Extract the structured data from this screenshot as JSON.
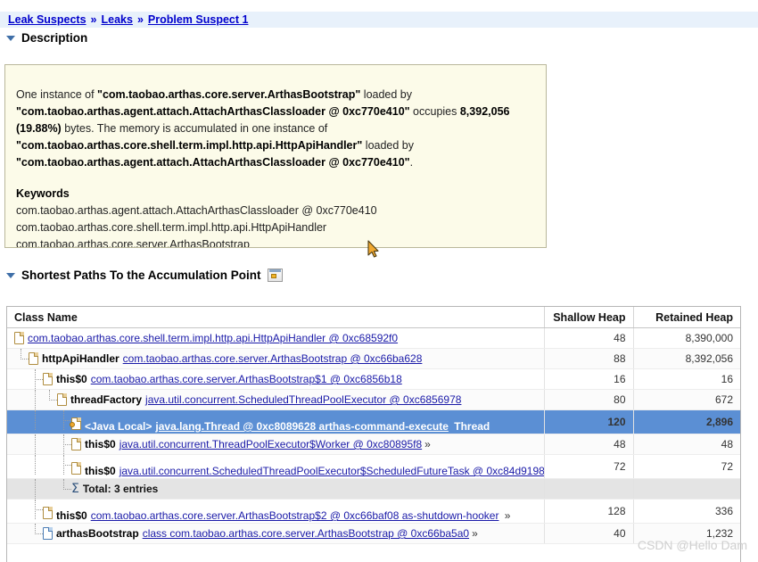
{
  "breadcrumb": {
    "items": [
      "Leak Suspects",
      "Leaks",
      "Problem Suspect 1"
    ],
    "separator": "»"
  },
  "sections": {
    "description": {
      "title": "Description"
    },
    "paths": {
      "title": "Shortest Paths To the Accumulation Point",
      "icon": "open-in-editor-icon"
    }
  },
  "description": {
    "paragraph": {
      "p1": "One instance of ",
      "b1": "\"com.taobao.arthas.core.server.ArthasBootstrap\"",
      "p2": " loaded by ",
      "b2": "\"com.taobao.arthas.agent.attach.AttachArthasClassloader @ 0xc770e410\"",
      "p3": " occupies ",
      "b3": "8,392,056 (19.88%)",
      "p4": " bytes. The memory is accumulated in one instance of ",
      "b4": "\"com.taobao.arthas.core.shell.term.impl.http.api.HttpApiHandler\"",
      "p5": " loaded by ",
      "b5": "\"com.taobao.arthas.agent.attach.AttachArthasClassloader @ 0xc770e410\"",
      "p6": "."
    },
    "keywords_title": "Keywords",
    "keywords": [
      "com.taobao.arthas.agent.attach.AttachArthasClassloader @ 0xc770e410",
      "com.taobao.arthas.core.shell.term.impl.http.api.HttpApiHandler",
      "com.taobao.arthas.core.server.ArthasBootstrap"
    ]
  },
  "table": {
    "columns": [
      "Class Name",
      "Shallow Heap",
      "Retained Heap"
    ],
    "rows": [
      {
        "depth": 0,
        "guides": [],
        "icon": "object-icon",
        "field": "",
        "class": "com.taobao.arthas.core.shell.term.impl.http.api.HttpApiHandler @ 0xc68592f0",
        "tail": "",
        "shallow": "48",
        "retained": "8,390,000",
        "selected": false,
        "wrapped": false,
        "total": false
      },
      {
        "depth": 1,
        "guides": [
          "ell"
        ],
        "icon": "object-icon",
        "field": "httpApiHandler",
        "class": "com.taobao.arthas.core.server.ArthasBootstrap @ 0xc66ba628",
        "tail": "",
        "shallow": "88",
        "retained": "8,392,056",
        "selected": false,
        "wrapped": false,
        "total": false
      },
      {
        "depth": 2,
        "guides": [
          "blank",
          "tee"
        ],
        "icon": "object-icon",
        "field": "this$0",
        "class": "com.taobao.arthas.core.server.ArthasBootstrap$1 @ 0xc6856b18",
        "tail": "",
        "shallow": "16",
        "retained": "16",
        "selected": false,
        "wrapped": false,
        "total": false
      },
      {
        "depth": 3,
        "guides": [
          "blank",
          "pipe",
          "ell"
        ],
        "icon": "object-icon",
        "field": "threadFactory",
        "class": "java.util.concurrent.ScheduledThreadPoolExecutor @ 0xc6856978",
        "tail": "",
        "shallow": "80",
        "retained": "672",
        "selected": false,
        "wrapped": false,
        "total": false
      },
      {
        "depth": 4,
        "guides": [
          "blank",
          "pipe",
          "blank",
          "tee"
        ],
        "icon": "thread-local-icon",
        "field": "<Java Local>",
        "class": "java.lang.Thread @ 0xc8089628 arthas-command-execute",
        "tail": "Thread",
        "shallow": "120",
        "retained": "2,896",
        "selected": true,
        "wrapped": true,
        "total": false
      },
      {
        "depth": 4,
        "guides": [
          "blank",
          "pipe",
          "blank",
          "tee"
        ],
        "icon": "object-icon",
        "field": "this$0",
        "class": "java.util.concurrent.ThreadPoolExecutor$Worker @ 0xc80895f8",
        "tail": "»",
        "shallow": "48",
        "retained": "48",
        "selected": false,
        "wrapped": false,
        "total": false
      },
      {
        "depth": 4,
        "guides": [
          "blank",
          "pipe",
          "blank",
          "tee"
        ],
        "icon": "object-icon",
        "field": "this$0",
        "class": "java.util.concurrent.ScheduledThreadPoolExecutor$ScheduledFutureTask @ 0xc84d9198",
        "tail": "»",
        "shallow": "72",
        "retained": "72",
        "selected": false,
        "wrapped": true,
        "total": false
      },
      {
        "depth": 4,
        "guides": [
          "blank",
          "pipe",
          "blank",
          "ell"
        ],
        "icon": "sum-icon",
        "field": "",
        "class": "",
        "tail": "",
        "total_label": "Total: 3 entries",
        "shallow": "",
        "retained": "",
        "selected": false,
        "wrapped": false,
        "total": true
      },
      {
        "depth": 2,
        "guides": [
          "blank",
          "tee"
        ],
        "icon": "object-icon",
        "field": "this$0",
        "class": "com.taobao.arthas.core.server.ArthasBootstrap$2 @ 0xc66baf08 as-shutdown-hooker",
        "tail": "»",
        "shallow": "128",
        "retained": "336",
        "selected": false,
        "wrapped": true,
        "total": false
      },
      {
        "depth": 2,
        "guides": [
          "blank",
          "ell"
        ],
        "icon": "class-icon",
        "field": "arthasBootstrap",
        "class": "class com.taobao.arthas.core.server.ArthasBootstrap @ 0xc66ba5a0",
        "tail": "»",
        "shallow": "40",
        "retained": "1,232",
        "selected": false,
        "wrapped": false,
        "total": false
      }
    ]
  },
  "watermark": {
    "text": "CSDN @Hello Dam"
  },
  "colors": {
    "selection": "#5b8fd4",
    "breadcrumb_bg": "#e8f1fb",
    "panel_bg": "#fcfbe9",
    "link": "#1a1aa8"
  }
}
